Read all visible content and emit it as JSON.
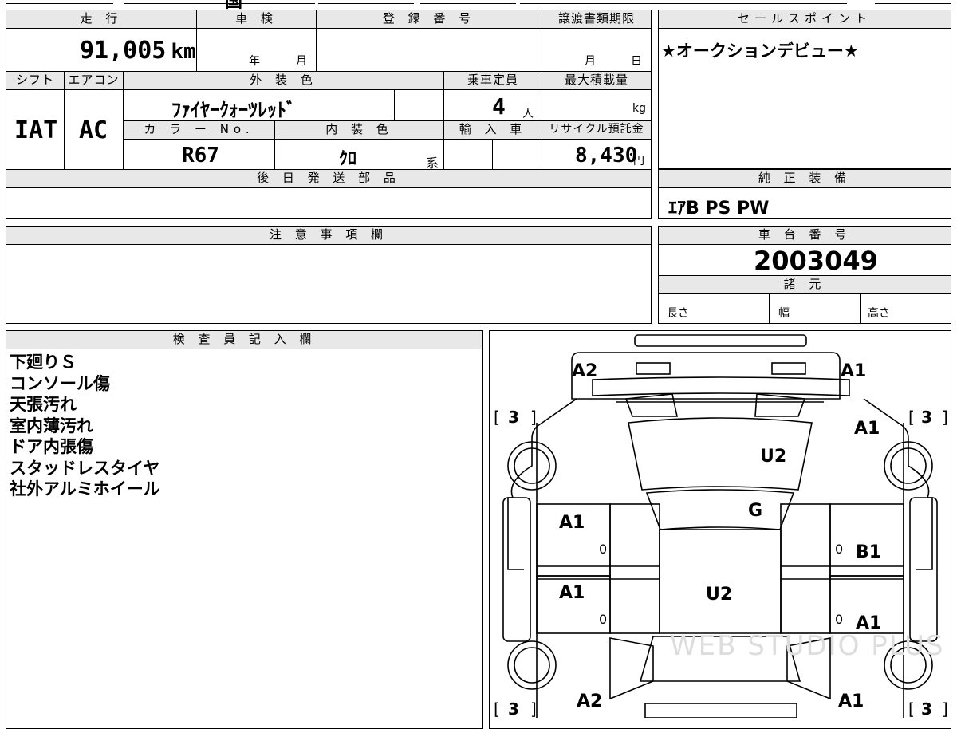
{
  "top_fragment": "国",
  "vehicle": {
    "mileage_label": "走 行",
    "mileage": "91,005",
    "mileage_unit": "km",
    "inspection_label": "車 検",
    "inspection_year": "年",
    "inspection_month": "月",
    "registration_label": "登 録 番 号",
    "registration_value": "",
    "transfer_label": "譲渡書類期限",
    "transfer_month": "月",
    "transfer_day": "日",
    "shift_label": "シフト",
    "shift": "IAT",
    "ac_label": "エアコン",
    "ac": "AC",
    "exterior_color_label": "外 装 色",
    "exterior_color": "ﾌｧｲﾔｰｸｫｰﾂﾚｯﾄﾞ",
    "capacity_label": "乗車定員",
    "capacity": "4",
    "capacity_unit": "人",
    "max_load_label": "最大積載量",
    "max_load_unit": "kg",
    "color_no_label": "カ ラ ー No.",
    "color_no": "R67",
    "interior_color_label": "内 装 色",
    "interior_color": "ｸﾛ",
    "interior_suffix": "系",
    "import_label": "輸 入 車",
    "recycle_label": "リサイクル預託金",
    "recycle_fee": "8,430",
    "recycle_unit": "円"
  },
  "later_parts_label": "後 日 発 送 部 品",
  "sales_point": {
    "label": "セールスポイント",
    "text": "★オークションデビュー★"
  },
  "equipment": {
    "label": "純 正 装 備",
    "text": "ｴｱB PS PW"
  },
  "notes_label": "注 意 事 項 欄",
  "chassis": {
    "label": "車 台 番 号",
    "number": "2003049"
  },
  "specs": {
    "label": "諸 元",
    "length": "長さ",
    "width": "幅",
    "height": "高さ"
  },
  "inspector": {
    "label": "検 査 員 記 入 欄",
    "remarks": [
      "下廻りＳ",
      "コンソール傷",
      "天張汚れ",
      "室内薄汚れ",
      "ドア内張傷",
      "スタッドレスタイヤ",
      "社外アルミホイール"
    ]
  },
  "diagram": {
    "front_left": "A2",
    "front_right": "A1",
    "tire_front_left": "3",
    "tire_front_right": "3",
    "tire_rear_left": "3",
    "tire_rear_right": "3",
    "fender_right": "A1",
    "windshield": "U2",
    "glass": "G",
    "roof": "U2",
    "door_front_left": "A1",
    "door_front_left_sub": "0",
    "door_front_right": "B1",
    "door_front_right_sub": "0",
    "door_rear_left": "A1",
    "door_rear_left_sub": "0",
    "door_rear_right": "A1",
    "door_rear_right_sub": "0",
    "rear_left": "A2",
    "rear_right": "A1"
  },
  "watermark": "WEB STUDIO PLUS"
}
